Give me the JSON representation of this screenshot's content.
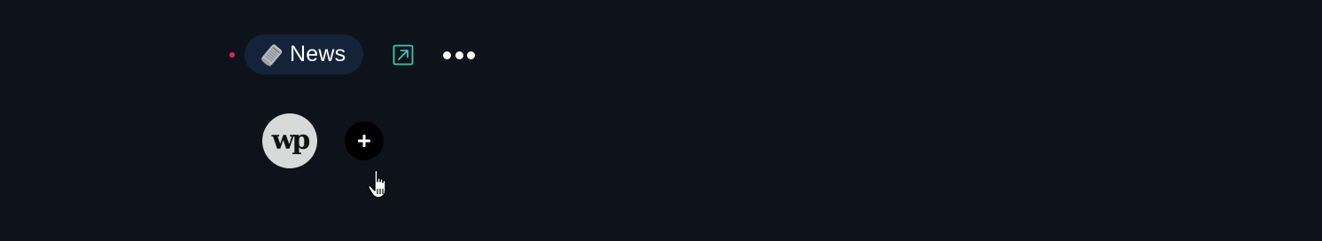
{
  "tab": {
    "label": "News",
    "emoji_icon": "rolled-newspaper-icon",
    "indicator_color": "#e0245e"
  },
  "toolbar": {
    "open_external_icon": "arrow-up-right-square-icon",
    "more_icon": "ellipsis-icon"
  },
  "sources": [
    {
      "logo_text": "wp",
      "icon": "washington-post-logo"
    }
  ],
  "add_button": {
    "icon": "plus-icon"
  },
  "colors": {
    "background": "#0e131b",
    "chip_background": "#15233a",
    "accent_teal": "#34c9b8"
  }
}
